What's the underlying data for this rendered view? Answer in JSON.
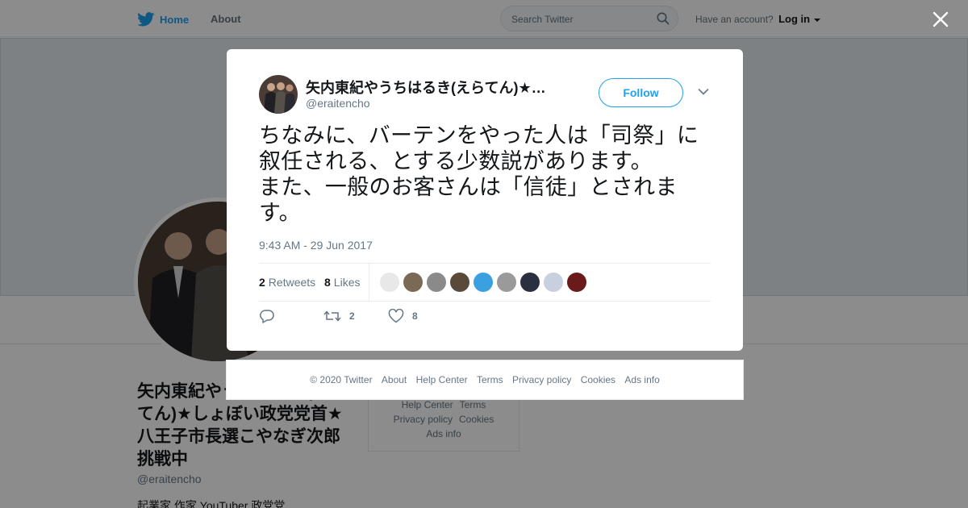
{
  "topbar": {
    "home_label": "Home",
    "about_label": "About",
    "search_placeholder": "Search Twitter",
    "account_prompt": "Have an account?",
    "login_label": "Log in"
  },
  "profile": {
    "name": "矢内東紀やうちはるき(えらてん)★しょぼい政党党首★八王子市長選こやなぎ次郎挑戦中",
    "handle": "@eraitencho",
    "bio_snippet": "起業家 作家 YouTuber 政党党"
  },
  "side_footer": {
    "links": [
      "Help Center",
      "Terms",
      "Privacy policy",
      "Cookies",
      "Ads info"
    ]
  },
  "tweet": {
    "display_name": "矢内東紀やうちはるき(えらてん)★…",
    "handle": "@eraitencho",
    "follow_label": "Follow",
    "text": "ちなみに、バーテンをやった人は「司祭」に叙任される、とする少数説があります。\nまた、一般のお客さんは「信徒」とされます。",
    "timestamp": "9:43 AM - 29 Jun 2017",
    "retweets_count": "2",
    "retweets_label": "Retweets",
    "likes_count": "8",
    "likes_label": "Likes",
    "retweet_action_count": "2",
    "like_action_count": "8",
    "liker_avatar_colors": [
      "#e8e8e8",
      "#7a6a55",
      "#8a8a8a",
      "#5a4a3a",
      "#3aa0e0",
      "#9a9a9a",
      "#2a3040",
      "#c8d0e0",
      "#6a1a1a"
    ]
  },
  "footer": {
    "copyright": "© 2020 Twitter",
    "links": [
      "About",
      "Help Center",
      "Terms",
      "Privacy policy",
      "Cookies",
      "Ads info"
    ]
  },
  "colors": {
    "brand_blue": "#1da1f2",
    "muted_text": "#657786",
    "border": "#e6ecf0"
  }
}
